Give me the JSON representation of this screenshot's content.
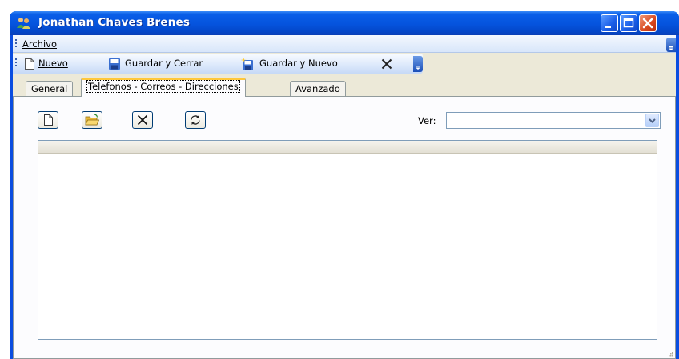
{
  "window": {
    "title": "Jonathan Chaves Brenes",
    "controls": [
      "minimize-icon",
      "maximize-icon",
      "close-icon"
    ]
  },
  "menubar": {
    "items": [
      {
        "label": "Archivo",
        "mnemonic": "A"
      }
    ]
  },
  "toolbar": {
    "new_label": "Nuevo",
    "save_close_label": "Guardar y Cerrar",
    "save_new_label": "Guardar y Nuevo",
    "delete_icon": "x-icon"
  },
  "tabs": [
    {
      "label": "General",
      "active": false
    },
    {
      "label": "Telefonos - Correos - Direcciones",
      "active": true
    },
    {
      "label": "Avanzado",
      "active": false
    }
  ],
  "panel": {
    "buttons": [
      "new-document-icon",
      "open-folder-icon",
      "delete-icon",
      "refresh-icon"
    ],
    "ver_label": "Ver:",
    "ver_value": ""
  },
  "colors": {
    "titlebar": "#0553dd",
    "accent_tab": "#ffc83c",
    "window_bg": "#ece9d8"
  }
}
